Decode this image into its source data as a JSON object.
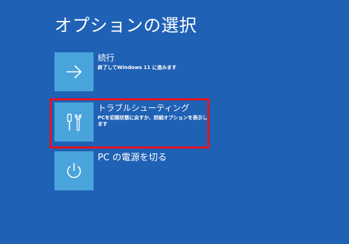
{
  "page": {
    "title": "オプションの選択",
    "background_color": "#1f61b5",
    "tile_color": "#4aa4dc"
  },
  "options": [
    {
      "title": "続行",
      "description": "終了してWindows 11 に進みます",
      "icon": "arrow-right-icon"
    },
    {
      "title": "トラブルシューティング",
      "description": "PCを初期状態に戻すか、詳細オプションを表示します",
      "icon": "tools-icon"
    },
    {
      "title": "PC の電源を切る",
      "icon": "power-icon"
    }
  ],
  "highlight": {
    "target": "トラブルシューティング",
    "color": "#e8121c"
  }
}
